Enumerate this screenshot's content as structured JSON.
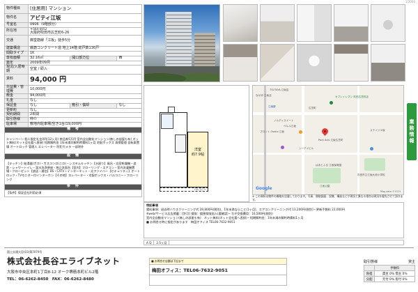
{
  "page_no": "1/2000",
  "spec": {
    "type_label": "物件種目",
    "type_value": "[住居用] マンション",
    "name_label": "物件名",
    "name_value": "アビティ江坂",
    "room_label": "号室名",
    "room_value": "0906（9階部分）",
    "addr_label": "所在地",
    "zip": "〒564-0052",
    "addr_value": "大阪府吹田市広芝町6-26",
    "access_label": "交通",
    "access_value": "御堂筋線「江坂」徒歩5分",
    "structure_label": "建築構造",
    "structure_value": "鉄筋コンクリート造 地上14階 総戸数130戸",
    "layout_label": "間取タイプ",
    "layout_value": "1K",
    "area_label": "専有面積",
    "area_value": "32.16㎡",
    "opening_label": "開口部方位",
    "opening_value": "西",
    "built_label": "築年",
    "built_value": "2009年09月",
    "occupancy_label": "現況/入居時期",
    "occupancy_value": "空室 / 即入",
    "rent_label": "賃料",
    "rent_value": "94,000 円",
    "fee_label": "共益費・管理費",
    "fee_value": "10,000円",
    "deposit_label": "敷金",
    "deposit_value": "94,000円",
    "key_label": "礼金",
    "key_value": "なし",
    "guarantee_label": "保証金",
    "guarantee_value": "なし",
    "shikibiki_label": "敷引・償却",
    "shikibiki_value": "なし",
    "renewal_label": "更新料",
    "renewal_value": "なし",
    "contract_label": "契約期間",
    "contract_value": "2年間",
    "rental_form_label": "取引態様",
    "rental_form_value": "仲介",
    "parking_label": "駐車場",
    "parking_value": "敷地内駐車場/空き1台/19,000円",
    "remarks_head": "備　考",
    "remarks_text": "キャンペーン 個人限定礼金0円(12ヶ月) 商品券5万円 室内全自動化マンション(無しの部屋も有) ネット無料(ネット会社要へ直接) 短期解約金 1年未満の解約時賃料1ヶ月 宅配ボックス 清掃管理 自転車置場 オートロック 管理人 エレベーター 防犯カメラ 一部除外",
    "equip_head": "設　備",
    "equip_text": "【キッチン】給湯器(ガス)・ガスコンロ(ニロ)・システムキッチン【水廻り】風呂・浴室乾燥機・追焚・シャワートイレ・温水洗浄便座・独立洗面台【室内】フローリング・エアコン・室内洗濯機置場・クローゼット【放送・通信】BS・CATV・インターネット・光ファイバー【セキュリティ】オートロック・TVモニター付インターホン【その他】エレベーター・宅配ボックス・バルコニー・フローリング",
    "cond_head": "条　件",
    "cond_text": "【条件】保証会社利用必須"
  },
  "floorplan": {
    "room_label": "洋室",
    "room_size": "約7.9帖",
    "balcony_label": "バルコニー"
  },
  "map": {
    "labels": {
      "tsutaya": "TSUTAYA 江坂店",
      "nico": "なか卯 江坂店",
      "esaka_station": "江坂駅",
      "hiroshiba": "広芝町",
      "seven": "セブンイレブン 吹田広芝町店",
      "nordic": "ノルディスイート",
      "pronto": "プロント Osaka 江坂",
      "senrimei": "ベルル江坂",
      "property": "Park Axis 江坂広芝町",
      "nishimura": "シーアイビル",
      "kindergarten": "はあとふる 江坂保育園",
      "esaka_park": "江坂公園",
      "hall": "吹田市立江坂大池小学校",
      "skymarine": "ステイジエ坂"
    },
    "google": "Google",
    "credit": "Map data ©2023"
  },
  "map_note": "※ この資料は物件の概略を記載しております。写真、間取図面、設備、構造などが現況と異なる場合は現況を優先させて頂きます。",
  "remarks": {
    "title": "特記事項",
    "line1": "賃料事項：退去時ハウスクリーニング代 39,800円(税別)、1年未満ならこと(1ヶ月)、エアコンクリーニング代 13,200円(税別)・更新手数料 22,000円",
    "line2": "※web/サービス広告掲載：[許可] 保険：損害保険加入(要確認)・カギ交換費用：16,500円(税別)",
    "line3": "室内全自動化マンション(無しの部屋も有)　ネット無料(ネット会社要へ直接)・短期解約金：1年未満の解約時賃料1ヶ月",
    "line4": "■ お問合せ時に指定があります　梅田オフィス TEL06-7632-9051"
  },
  "bottom_strip": {
    "label": "A D",
    "value": "2.5ヶ月"
  },
  "footer": {
    "license": "国土交通大臣(03)第7079号",
    "company": "株式会社長谷エライブネット",
    "address": "大阪市中央区本町1丁目8-12 オーク堺筋本町ビル2階",
    "tel": "TEL：06-6262-8450　FAX：06-6262-8480",
    "sales_note": "■ お問合せ店舗は下記まで",
    "sales_office": "梅田オフィス：TEL06-7632-9051",
    "deal_title": "取引態様",
    "deal_status": "貸主",
    "deal_headers": [
      "",
      "手数料"
    ],
    "deal_rows": [
      [
        "負担",
        "貸主 0% 借主 0%"
      ],
      [
        "分配",
        "元付 0% 客付 0%"
      ]
    ]
  }
}
